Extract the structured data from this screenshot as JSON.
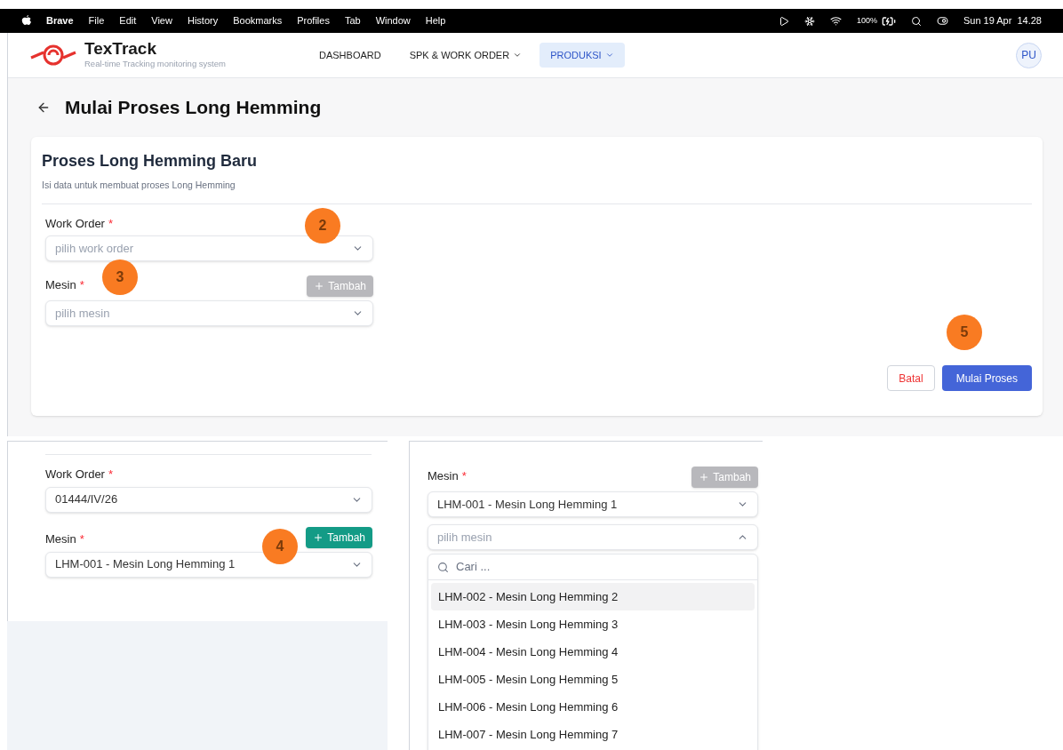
{
  "menu_bar": {
    "app": "Brave",
    "items": [
      "File",
      "Edit",
      "View",
      "History",
      "Bookmarks",
      "Profiles",
      "Tab",
      "Window",
      "Help"
    ],
    "battery": "100%",
    "clock": "Sun 19 Apr  14.28"
  },
  "header": {
    "logo": "TexTrack",
    "tagline": "Real-time Tracking monitoring system",
    "nav": [
      {
        "label": "DASHBOARD",
        "selected": false,
        "dropdown": false
      },
      {
        "label": "SPK & WORK ORDER",
        "selected": false,
        "dropdown": true
      },
      {
        "label": "PRODUKSI",
        "selected": true,
        "dropdown": true
      }
    ],
    "avatar": "PU"
  },
  "page": {
    "title": "Mulai Proses Long Hemming"
  },
  "card": {
    "title": "Proses Long Hemming Baru",
    "subtitle": "Isi data untuk membuat proses Long Hemming",
    "work_order": {
      "label": "Work Order",
      "required": "*",
      "placeholder": "pilih work order"
    },
    "machine": {
      "label": "Mesin",
      "required": "*",
      "placeholder": "pilih mesin",
      "add_button": {
        "label": "Tambah",
        "disabled": true
      }
    },
    "buttons": [
      {
        "label": "Batal",
        "kind": "secondary"
      },
      {
        "label": "Mulai Proses",
        "kind": "primary"
      }
    ]
  },
  "inset_left": {
    "work_order": {
      "label": "Work Order",
      "required": "*",
      "value": "01444/IV/26"
    },
    "machine": {
      "label": "Mesin",
      "required": "*",
      "value": "LHM-001 - Mesin Long Hemming 1",
      "add_button": {
        "label": "Tambah",
        "disabled": false
      }
    }
  },
  "inset_right": {
    "machine": {
      "label": "Mesin",
      "required": "*",
      "value": "LHM-001 - Mesin Long Hemming 1",
      "add_button": {
        "label": "Tambah",
        "disabled": true
      }
    },
    "second_select": {
      "placeholder": "pilih mesin",
      "expanded": true
    },
    "search": {
      "placeholder": "Cari ..."
    },
    "options": [
      {
        "label": "LHM-002 - Mesin Long Hemming 2",
        "selected": true
      },
      {
        "label": "LHM-003 - Mesin Long Hemming 3",
        "selected": false
      },
      {
        "label": "LHM-004 - Mesin Long Hemming 4",
        "selected": false
      },
      {
        "label": "LHM-005 - Mesin Long Hemming 5",
        "selected": false
      },
      {
        "label": "LHM-006 - Mesin Long Hemming 6",
        "selected": false
      },
      {
        "label": "LHM-007 - Mesin Long Hemming 7",
        "selected": false
      }
    ]
  },
  "step_badges": [
    "2",
    "3",
    "4",
    "5"
  ]
}
